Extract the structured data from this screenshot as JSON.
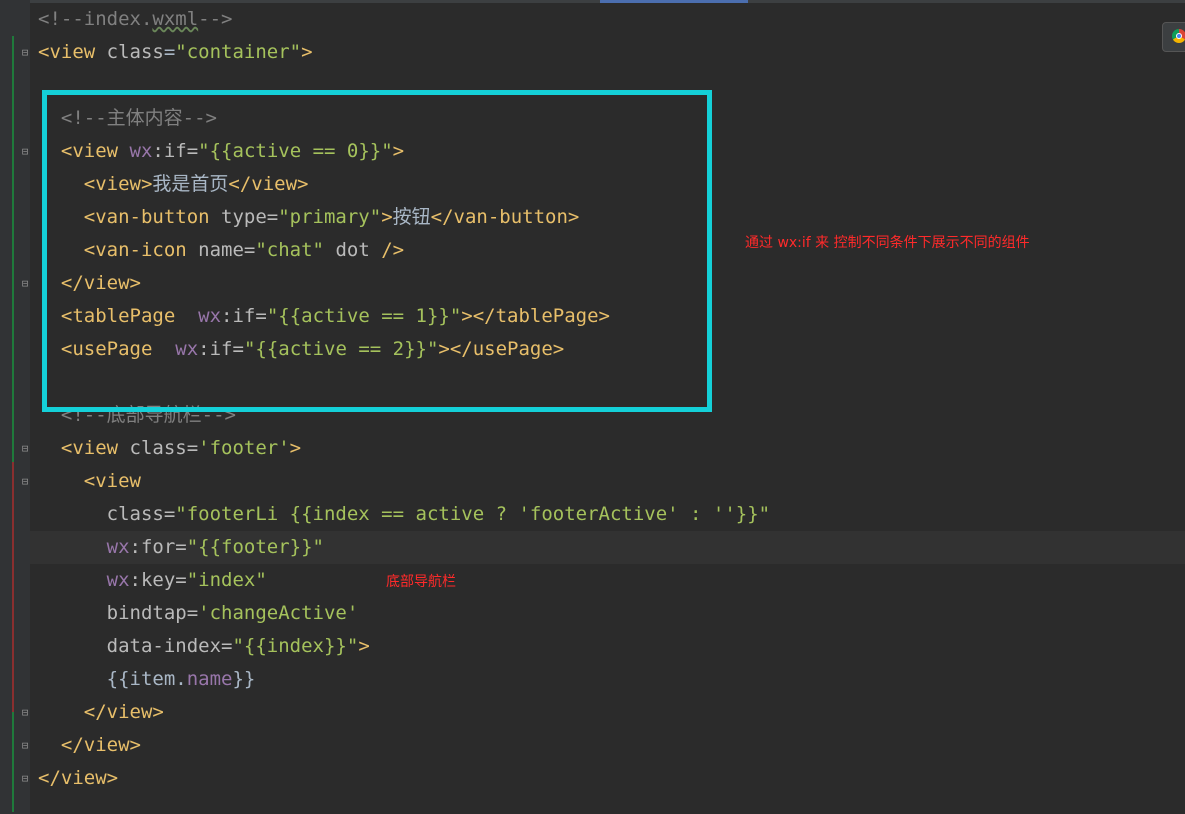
{
  "editor": {
    "lines": [
      {
        "id": "l1",
        "parts": [
          [
            "comment",
            "<!--index."
          ],
          [
            "comment-ul",
            "wxml"
          ],
          [
            "comment",
            "-->"
          ]
        ]
      },
      {
        "id": "l2",
        "parts": [
          [
            "tag",
            "<view "
          ],
          [
            "attr",
            "class"
          ],
          [
            "bracket",
            "="
          ],
          [
            "str",
            "\"container\""
          ],
          [
            "tag",
            ">"
          ]
        ]
      },
      {
        "id": "l3",
        "parts": []
      },
      {
        "id": "l4",
        "parts": [
          [
            "comment",
            "  <!--主体内容-->"
          ]
        ]
      },
      {
        "id": "l5",
        "parts": [
          [
            "tag",
            "  <view "
          ],
          [
            "wx",
            "wx"
          ],
          [
            "attr",
            ":if="
          ],
          [
            "str",
            "\"{{"
          ],
          [
            "str",
            "active == 0"
          ],
          [
            "str",
            "}}\""
          ],
          [
            "tag",
            ">"
          ]
        ]
      },
      {
        "id": "l6",
        "parts": [
          [
            "tag",
            "    <view>"
          ],
          [
            "bracket",
            "我是首页"
          ],
          [
            "tag",
            "</view>"
          ]
        ]
      },
      {
        "id": "l7",
        "parts": [
          [
            "tag",
            "    <van-button "
          ],
          [
            "attr",
            "type="
          ],
          [
            "str",
            "\"primary\""
          ],
          [
            "tag",
            ">"
          ],
          [
            "bracket",
            "按钮"
          ],
          [
            "tag",
            "</van-button>"
          ]
        ]
      },
      {
        "id": "l8",
        "parts": [
          [
            "tag",
            "    <van-icon "
          ],
          [
            "attr",
            "name="
          ],
          [
            "str",
            "\"chat\""
          ],
          [
            "attr",
            " dot "
          ],
          [
            "tag",
            "/>"
          ]
        ]
      },
      {
        "id": "l9",
        "parts": [
          [
            "tag",
            "  </view>"
          ]
        ]
      },
      {
        "id": "l10",
        "parts": [
          [
            "tag",
            "  <tablePage  "
          ],
          [
            "wx",
            "wx"
          ],
          [
            "attr",
            ":if="
          ],
          [
            "str",
            "\"{{active == 1}}\""
          ],
          [
            "tag",
            "></tablePage>"
          ]
        ]
      },
      {
        "id": "l11",
        "parts": [
          [
            "tag",
            "  <usePage  "
          ],
          [
            "wx",
            "wx"
          ],
          [
            "attr",
            ":if="
          ],
          [
            "str",
            "\"{{active == 2}}\""
          ],
          [
            "tag",
            "></usePage>"
          ]
        ]
      },
      {
        "id": "l12",
        "parts": []
      },
      {
        "id": "l13",
        "parts": [
          [
            "comment",
            "  <!--底部导航栏-->"
          ]
        ]
      },
      {
        "id": "l14",
        "parts": [
          [
            "tag",
            "  <view "
          ],
          [
            "attr",
            "class="
          ],
          [
            "str",
            "'footer'"
          ],
          [
            "tag",
            ">"
          ]
        ]
      },
      {
        "id": "l15",
        "parts": [
          [
            "tag",
            "    <view"
          ]
        ]
      },
      {
        "id": "l16",
        "parts": [
          [
            "attr",
            "      class="
          ],
          [
            "str",
            "\"footerLi {{index == active ? 'footerActive' : ''}}\""
          ]
        ]
      },
      {
        "id": "l17",
        "parts": [
          [
            "wx",
            "      wx"
          ],
          [
            "attr",
            ":for="
          ],
          [
            "str",
            "\"{{footer}}\""
          ]
        ]
      },
      {
        "id": "l18",
        "parts": [
          [
            "wx",
            "      wx"
          ],
          [
            "attr",
            ":key="
          ],
          [
            "str",
            "\"index\""
          ]
        ]
      },
      {
        "id": "l19",
        "parts": [
          [
            "attr",
            "      bindtap="
          ],
          [
            "str",
            "'changeActive'"
          ]
        ]
      },
      {
        "id": "l20",
        "parts": [
          [
            "attr",
            "      data-index="
          ],
          [
            "str",
            "\"{{index}}\""
          ],
          [
            "tag",
            ">"
          ]
        ]
      },
      {
        "id": "l21",
        "parts": [
          [
            "bracket",
            "      {{item."
          ],
          [
            "wx",
            "name"
          ],
          [
            "bracket",
            "}}"
          ]
        ]
      },
      {
        "id": "l22",
        "parts": [
          [
            "tag",
            "    </view>"
          ]
        ]
      },
      {
        "id": "l23",
        "parts": [
          [
            "tag",
            "  </view>"
          ]
        ]
      },
      {
        "id": "l24",
        "parts": [
          [
            "tag",
            "</view>"
          ]
        ]
      }
    ]
  },
  "annotations": {
    "wxif_note": "通过  wx:if  来 控制不同条件下展示不同的组件",
    "footer_note": "底部导航栏"
  },
  "colors": {
    "highlight_box": "#14d0d8",
    "annotation": "#ff2a2a"
  }
}
